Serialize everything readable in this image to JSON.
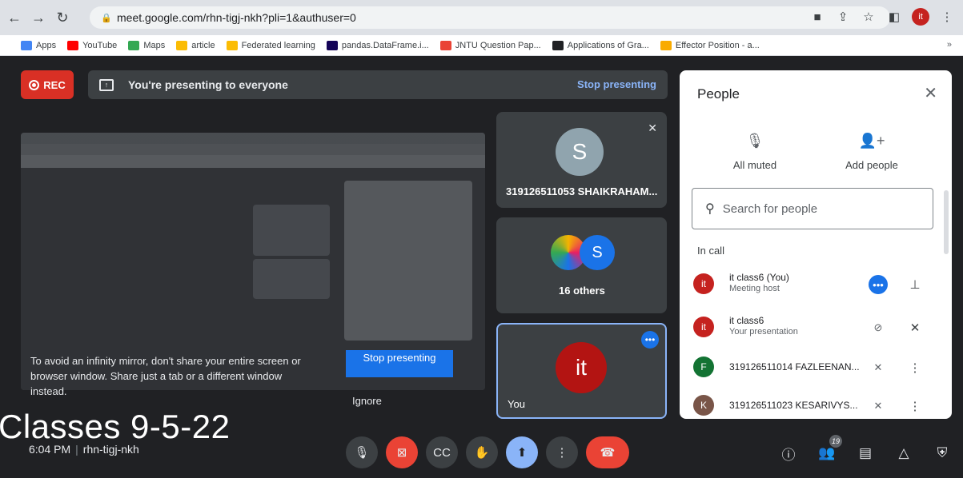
{
  "browser": {
    "url": "meet.google.com/rhn-tigj-nkh?pli=1&authuser=0",
    "profile_initial": "it",
    "bookmarks": [
      {
        "label": "Apps",
        "color": "#4285f4"
      },
      {
        "label": "YouTube",
        "color": "#ff0000"
      },
      {
        "label": "Maps",
        "color": "#34a853"
      },
      {
        "label": "article",
        "color": "#fbbc04"
      },
      {
        "label": "Federated learning",
        "color": "#fbbc04"
      },
      {
        "label": "pandas.DataFrame.i...",
        "color": "#150458"
      },
      {
        "label": "JNTU Question Pap...",
        "color": "#ea4335"
      },
      {
        "label": "Applications of Gra...",
        "color": "#202124"
      },
      {
        "label": "Effector Position - a...",
        "color": "#f9ab00"
      }
    ],
    "more_bookmarks": "»"
  },
  "meet": {
    "rec_label": "REC",
    "presenting_text": "You're presenting to everyone",
    "stop_presenting_link": "Stop presenting",
    "mirror_warning": "To avoid an infinity mirror, don't share your entire screen or browser window. Share just a tab or a different window instead.",
    "stop_presenting_button": "Stop presenting",
    "ignore_label": "Ignore",
    "tiles": [
      {
        "name": "319126511053 SHAIKRAHAM...",
        "initial": "S",
        "color": "#90a4ae"
      },
      {
        "name": "16 others",
        "initial": "S",
        "color": "#1a73e8"
      },
      {
        "name": "You",
        "initial": "it",
        "color": "#b31412"
      }
    ],
    "caption": "Classes 9-5-22",
    "time": "6:04 PM",
    "meeting_code": "rhn-tigj-nkh",
    "participant_count": "19"
  },
  "people": {
    "title": "People",
    "all_muted": "All muted",
    "add_people": "Add people",
    "search_placeholder": "Search for people",
    "section_label": "In call",
    "rows": [
      {
        "initial": "it",
        "name": "it class6 (You)",
        "role": "Meeting host",
        "color": "#c5221f"
      },
      {
        "initial": "it",
        "name": "it class6",
        "role": "Your presentation",
        "color": "#c5221f"
      },
      {
        "initial": "F",
        "name": "319126511014 FAZLEENAN...",
        "role": "",
        "color": "#137333"
      },
      {
        "initial": "K",
        "name": "319126511023 KESARIVYS...",
        "role": "",
        "color": "#795548"
      }
    ]
  }
}
